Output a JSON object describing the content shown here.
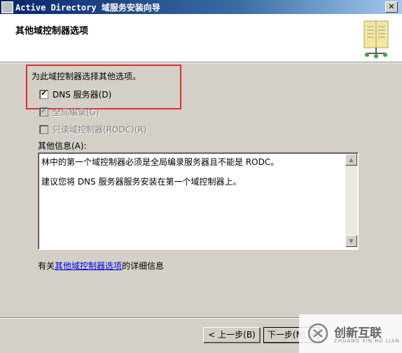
{
  "window": {
    "title": "Active Directory 域服务安装向导",
    "close_glyph": "✕"
  },
  "header": {
    "heading": "其他域控制器选项"
  },
  "main": {
    "instruction": "为此域控制器选择其他选项。",
    "options": [
      {
        "label": "DNS 服务器(D)",
        "checked": true,
        "enabled": true
      },
      {
        "label": "全局编录(G)",
        "checked": true,
        "enabled": false
      },
      {
        "label": "只读域控制器(RODC)(R)",
        "checked": false,
        "enabled": false
      }
    ],
    "info_label": "其他信息(A):",
    "info_lines": [
      "林中的第一个域控制器必须是全局编录服务器且不能是 RODC。",
      "建议您将 DNS 服务器服务安装在第一个域控制器上。"
    ],
    "more_info_prefix": "有关",
    "more_info_link": "其他域控制器选项",
    "more_info_suffix": "的详细信息"
  },
  "footer": {
    "back_label": "< 上一步(B)",
    "next_label": "下一步(N) >"
  },
  "watermark": {
    "brand": "创新互联",
    "sub": "CHUANG XIN HU LIAN"
  },
  "colors": {
    "highlight_border": "#e03030",
    "link": "#0000ee",
    "dialog_bg": "#d4d0c8"
  }
}
